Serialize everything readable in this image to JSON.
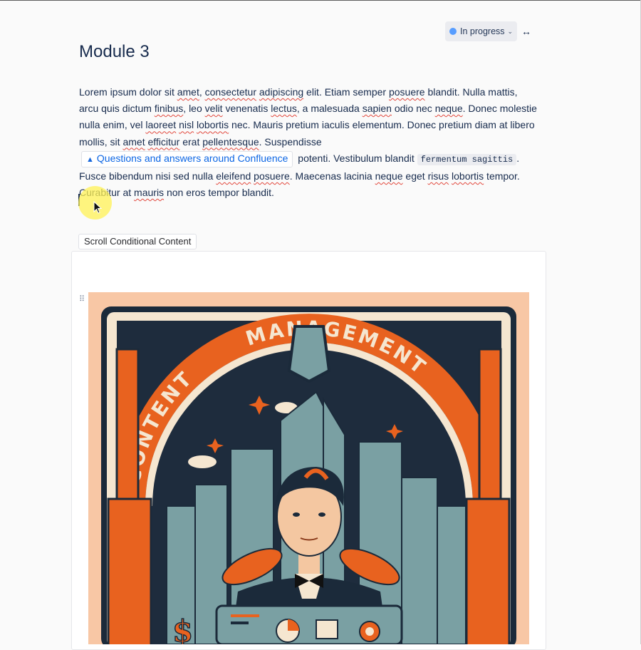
{
  "status": {
    "label": "In progress",
    "dot_color": "#579dff"
  },
  "width_toggle_icon": "expand-width-icon",
  "page": {
    "title": "Module 3"
  },
  "paragraph": {
    "p1": "Lorem ipsum dolor sit ",
    "w_amet": "amet",
    "p2": ", ",
    "w_consectetur": "consectetur",
    "p3": " ",
    "w_adipiscing": "adipiscing",
    "p4": " elit. Etiam semper ",
    "w_posuere": "posuere",
    "p5": " blandit. Nulla mattis, arcu quis dictum ",
    "w_finibus": "finibus",
    "p6": ", leo ",
    "w_velit": "velit",
    "p7": " venenatis ",
    "w_lectus": "lectus",
    "p8": ", a malesuada ",
    "w_sapien": "sapien",
    "p9": " odio nec ",
    "w_neque": "neque",
    "p10": ". Donec molestie nulla enim, vel ",
    "w_laoreet": "laoreet",
    "p11": " ",
    "w_nisl": "nisl",
    "p12": " ",
    "w_lobortis": "lobortis",
    "p13": " nec. Mauris pretium iaculis elementum. Donec pretium diam at libero mollis, sit ",
    "w_amet2": "amet",
    "p14": " ",
    "w_efficitur": "efficitur",
    "p15": " erat ",
    "w_pellentesque": "pellentesque",
    "p16": ". Suspendisse",
    "link_text": "Questions and answers around Confluence",
    "p17": " potenti. Vestibulum blandit ",
    "code_text": "fermentum sagittis",
    "p18": ". Fusce bibendum nisi sed nulla ",
    "w_eleifend": "eleifend",
    "p19": " ",
    "w_posuere2": "posuere",
    "p20": ". Maecenas lacinia ",
    "w_neque2": "neque",
    "p21": " eget ",
    "w_risus": "risus",
    "p22": " ",
    "w_lobortis2": "lobortis",
    "p23": " tempor. Curabitur at ",
    "w_mauris": "mauris",
    "p24": " non eros tempor blandit."
  },
  "macro": {
    "label": "Scroll Conditional Content"
  },
  "poster": {
    "arch_text_left": "CONTENT",
    "arch_text_right": "MANAGEMENT",
    "colors": {
      "orange": "#e8621f",
      "peach": "#f8c7a5",
      "navy": "#1b2a3a",
      "teal": "#7aa0a3",
      "cream": "#f5e6d0"
    }
  }
}
